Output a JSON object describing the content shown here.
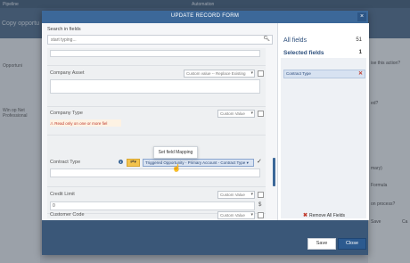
{
  "background": {
    "topbar_left": "Pipeline",
    "topbar_center": "Automation",
    "page_title": "Copy opportu",
    "left_items": [
      "Opportuni",
      "Win op Net Professional"
    ],
    "right_items": [
      "ise this action?",
      "ed?",
      "mary)",
      "Formula",
      "on process?",
      "Save",
      "Ca"
    ]
  },
  "modal": {
    "title": "UPDATE RECORD FORM",
    "close_icon": "×"
  },
  "search": {
    "label": "Search in fields",
    "placeholder": "start typing...",
    "icon": "search-icon"
  },
  "fields": [
    {
      "label": "Company Asset",
      "select": "Custom value -- Replace Existing"
    },
    {
      "label": "Company Type",
      "select": "Custom Value",
      "warning": "Read only on one or more fiel"
    },
    {
      "label": "Contract Type",
      "mapping": "Triggered Opportunity - Primary Account - Contract Type"
    },
    {
      "label": "Credit Limit",
      "select": "Custom Value",
      "input_value": "0",
      "suffix": "$"
    },
    {
      "label": "Customer Code",
      "select": "Custom Value"
    }
  ],
  "tooltip": "Set field Mapping",
  "right_pane": {
    "all_fields_label": "All fields",
    "all_fields_count": "51",
    "selected_fields_label": "Selected fields",
    "selected_fields_count": "1",
    "selected_items": [
      "Contract Type"
    ],
    "remove_all_label": "Remove All Fields"
  },
  "footer": {
    "save_label": "Save",
    "close_label": "Close"
  },
  "colors": {
    "header": "#3c6899",
    "footer": "#3a5778",
    "accent": "#2c5a8f",
    "mapping_button": "#f3c34d",
    "danger": "#c0392b"
  }
}
